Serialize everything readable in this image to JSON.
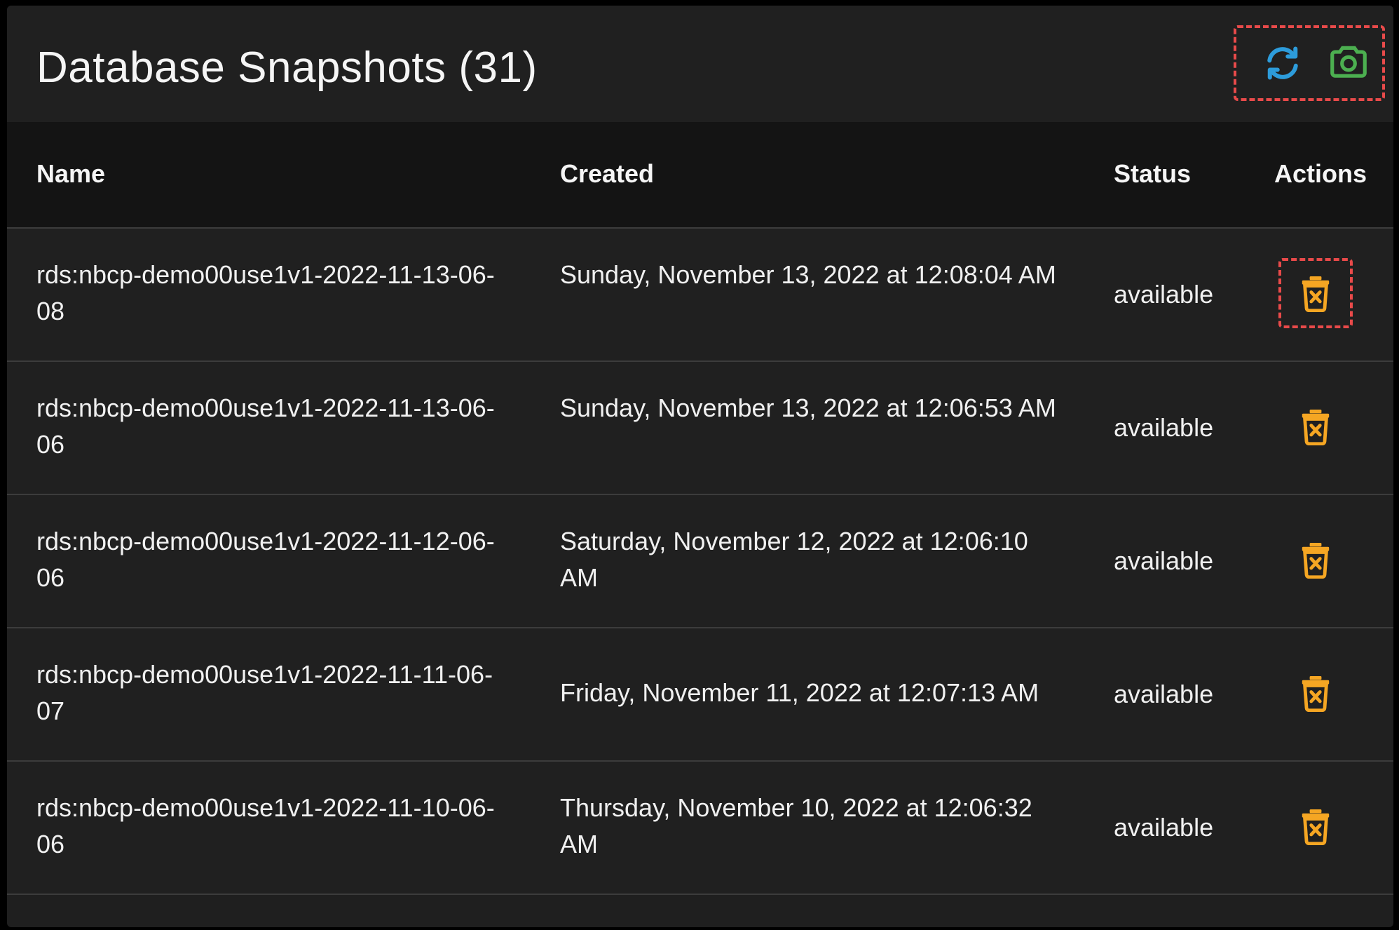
{
  "header": {
    "title": "Database Snapshots (31)",
    "icons": {
      "refresh": "refresh-icon",
      "snapshot": "camera-icon"
    }
  },
  "table": {
    "columns": [
      "Name",
      "Created",
      "Status",
      "Actions"
    ],
    "rows": [
      {
        "name": "rds:nbcp-demo00use1v1-2022-11-13-06-08",
        "created": "Sunday, November 13, 2022 at 12:08:04 AM",
        "status": "available"
      },
      {
        "name": "rds:nbcp-demo00use1v1-2022-11-13-06-06",
        "created": "Sunday, November 13, 2022 at 12:06:53 AM",
        "status": "available"
      },
      {
        "name": "rds:nbcp-demo00use1v1-2022-11-12-06-06",
        "created": "Saturday, November 12, 2022 at 12:06:10 AM",
        "status": "available"
      },
      {
        "name": "rds:nbcp-demo00use1v1-2022-11-11-06-07",
        "created": "Friday, November 11, 2022 at 12:07:13 AM",
        "status": "available"
      },
      {
        "name": "rds:nbcp-demo00use1v1-2022-11-10-06-06",
        "created": "Thursday, November 10, 2022 at 12:06:32 AM",
        "status": "available"
      }
    ],
    "action_icon": "delete-icon"
  },
  "colors": {
    "refresh": "#2d9cdb",
    "snapshot": "#4caf50",
    "delete": "#f5a623",
    "highlight": "#e84a4a"
  }
}
